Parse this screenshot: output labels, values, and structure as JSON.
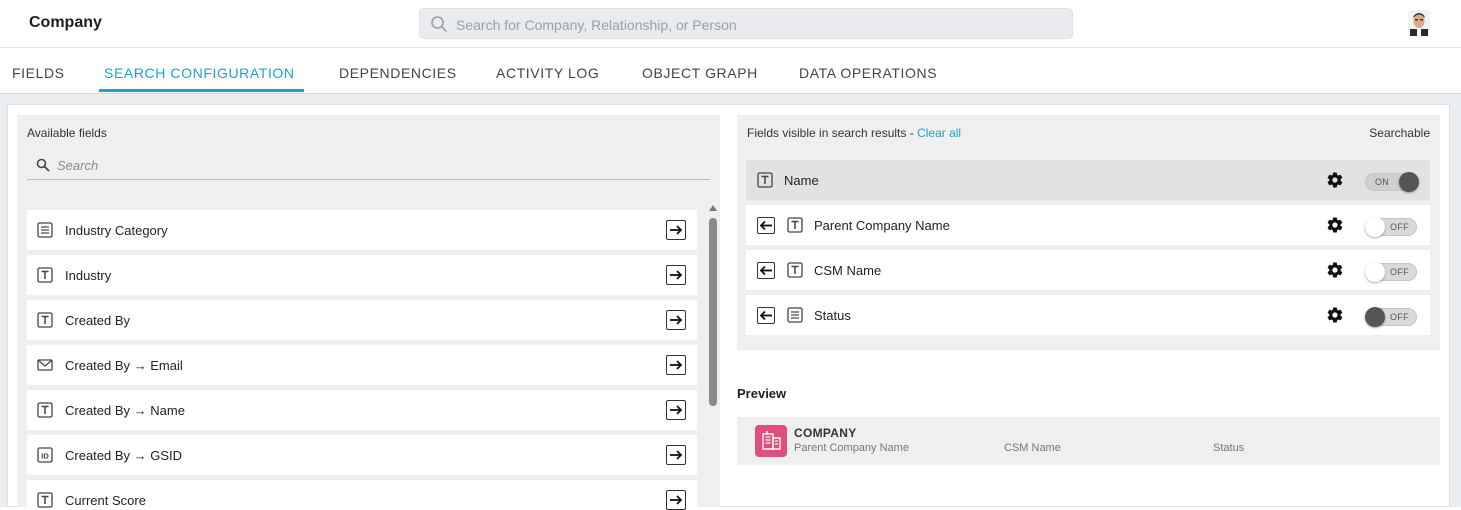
{
  "header": {
    "title": "Company",
    "search_placeholder": "Search for Company, Relationship, or Person"
  },
  "tabs": [
    {
      "label": "FIELDS",
      "active": false
    },
    {
      "label": "SEARCH CONFIGURATION",
      "active": true
    },
    {
      "label": "DEPENDENCIES",
      "active": false
    },
    {
      "label": "ACTIVITY LOG",
      "active": false
    },
    {
      "label": "OBJECT GRAPH",
      "active": false
    },
    {
      "label": "DATA OPERATIONS",
      "active": false
    }
  ],
  "available": {
    "title": "Available fields",
    "search_placeholder": "Search",
    "fields": [
      {
        "label": "Industry Category",
        "icon": "dropdown-list-icon"
      },
      {
        "label": "Industry",
        "icon": "text-field-icon"
      },
      {
        "label": "Created By",
        "icon": "text-field-icon"
      },
      {
        "label": "Created By → Email",
        "icon": "email-icon"
      },
      {
        "label": "Created By → Name",
        "icon": "text-field-icon"
      },
      {
        "label": "Created By → GSID",
        "icon": "id-field-icon"
      },
      {
        "label": "Current Score",
        "icon": "text-field-icon"
      }
    ]
  },
  "visible": {
    "title": "Fields visible in search results - ",
    "clear_all": "Clear all",
    "searchable_label": "Searchable",
    "fields": [
      {
        "label": "Name",
        "icon": "text-field-icon",
        "removable": false,
        "searchable": "ON"
      },
      {
        "label": "Parent Company Name",
        "icon": "text-field-icon",
        "removable": true,
        "searchable": "OFF"
      },
      {
        "label": "CSM Name",
        "icon": "text-field-icon",
        "removable": true,
        "searchable": "OFF"
      },
      {
        "label": "Status",
        "icon": "dropdown-list-icon",
        "removable": true,
        "searchable": "OFF"
      }
    ]
  },
  "preview": {
    "title": "Preview",
    "object_name": "COMPANY",
    "columns": [
      "Parent Company Name",
      "CSM Name",
      "Status"
    ]
  },
  "colors": {
    "accent": "#1ba3c7",
    "preview_icon": "#e04f7b"
  }
}
